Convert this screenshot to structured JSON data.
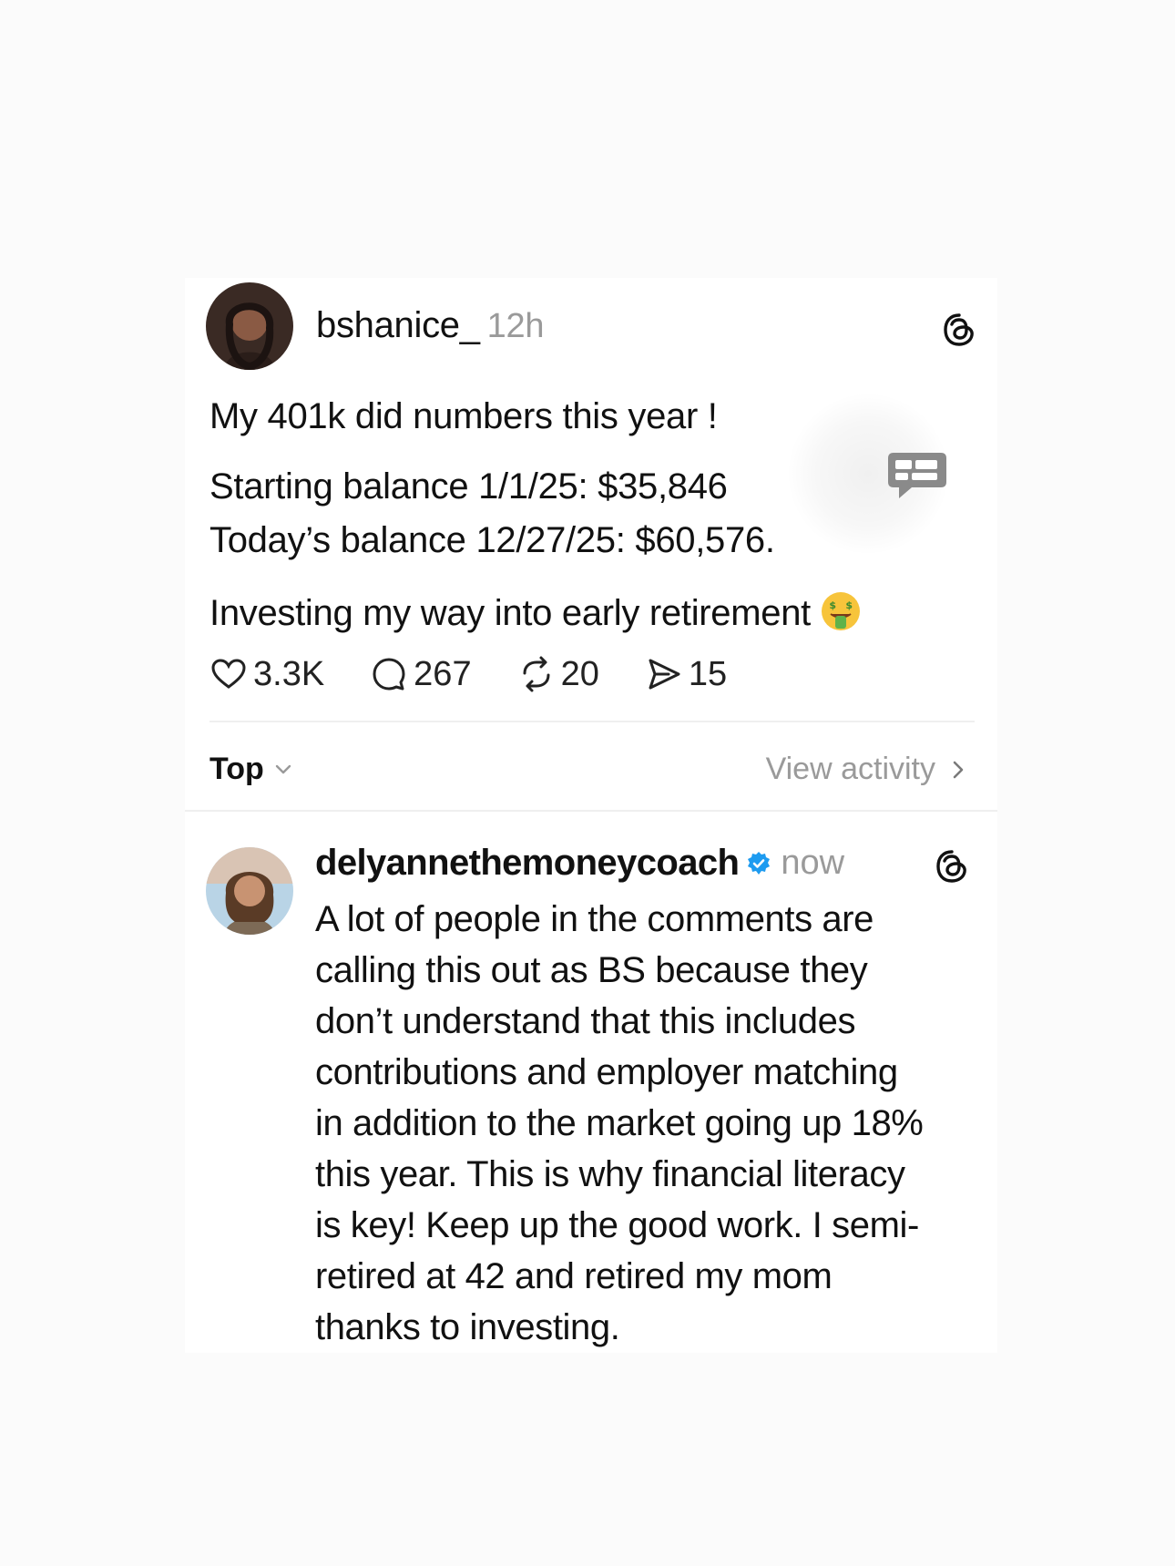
{
  "post": {
    "username": "bshanice_",
    "timestamp": "12h",
    "text_lines": [
      "My 401k did numbers this year !",
      "Starting balance 1/1/25: $35,846",
      "Today’s balance 12/27/25: $60,576.",
      "Investing my way into early retirement"
    ],
    "emoji_icon": "money-mouth-face-icon",
    "actions": {
      "likes": "3.3K",
      "replies": "267",
      "reposts": "20",
      "shares": "15"
    }
  },
  "sort": {
    "label": "Top",
    "view_activity": "View activity"
  },
  "reply": {
    "username": "delyannethemoneycoach",
    "timestamp": "now",
    "verified": true,
    "text_lines": [
      "A lot of people in the comments are",
      "calling this out as BS because they",
      "don’t understand that this includes",
      "contributions and employer matching",
      "in addition to the market going up 18%",
      "this year. This is why financial literacy",
      "is key! Keep up the good work. I semi-",
      "retired at 42 and retired my mom",
      "thanks to investing."
    ]
  },
  "colors": {
    "text": "#111111",
    "muted": "#9a9a9a",
    "verified": "#1d9bf0",
    "background": "#ffffff"
  }
}
